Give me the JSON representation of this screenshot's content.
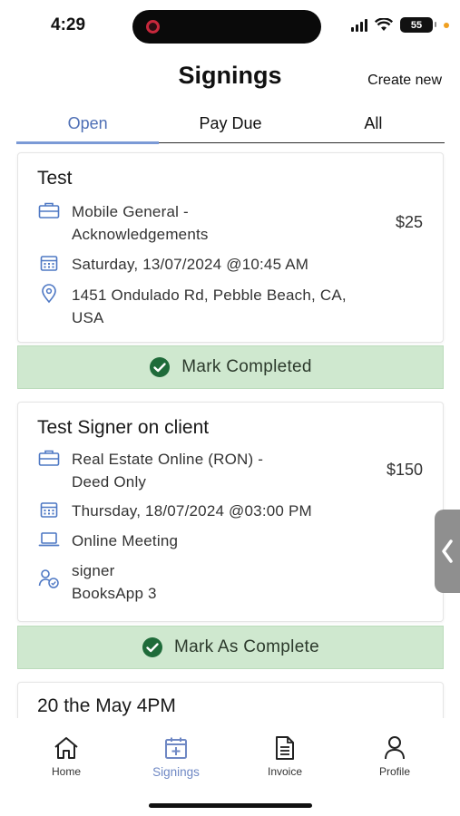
{
  "status": {
    "time": "4:29",
    "battery": "55"
  },
  "header": {
    "title": "Signings",
    "create_new": "Create new"
  },
  "tabs": [
    {
      "label": "Open",
      "active": true
    },
    {
      "label": "Pay Due",
      "active": false
    },
    {
      "label": "All",
      "active": false
    }
  ],
  "signings": [
    {
      "title": "Test",
      "service": [
        "Mobile General -",
        "Acknowledgements"
      ],
      "price": "$25",
      "datetime": "Saturday, 13/07/2024 @10:45 AM",
      "location": [
        "1451 Ondulado Rd, Pebble Beach, CA,",
        "USA"
      ],
      "action_label": "Mark Completed"
    },
    {
      "title": "Test Signer on client",
      "service": [
        "Real Estate Online (RON) -",
        "Deed Only"
      ],
      "price": "$150",
      "datetime": "Thursday, 18/07/2024 @03:00 PM",
      "meeting": "Online Meeting",
      "signer": [
        "signer",
        "BooksApp 3"
      ],
      "action_label": "Mark As Complete"
    },
    {
      "title": "20 the May 4PM"
    }
  ],
  "bottom_nav": [
    {
      "label": "Home",
      "icon": "home-icon",
      "active": false
    },
    {
      "label": "Signings",
      "icon": "calendar-plus-icon",
      "active": true
    },
    {
      "label": "Invoice",
      "icon": "document-icon",
      "active": false
    },
    {
      "label": "Profile",
      "icon": "person-icon",
      "active": false
    }
  ],
  "colors": {
    "accent": "#4e6fb5",
    "action_bg": "#cfe8cf",
    "check": "#1f6b3a"
  }
}
